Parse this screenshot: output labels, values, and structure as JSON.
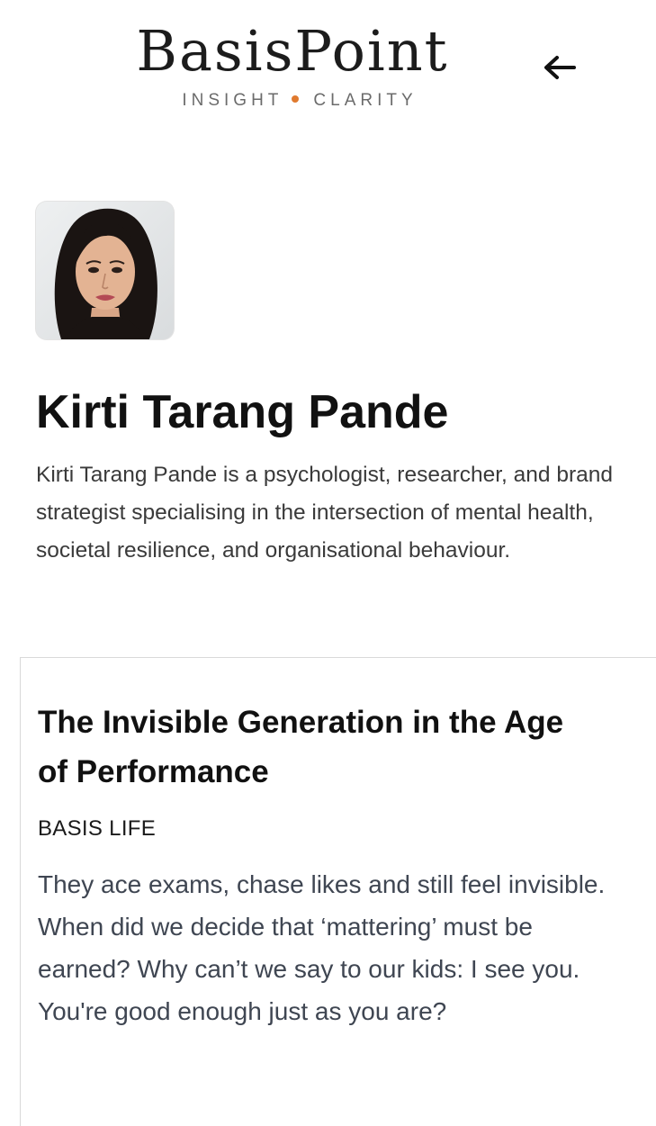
{
  "header": {
    "logo_text": "BasisPoint",
    "tagline_left": "INSIGHT",
    "tagline_right": "CLARITY",
    "back_icon": "arrow-left-icon"
  },
  "author": {
    "avatar_alt": "Kirti Tarang Pande",
    "name": "Kirti Tarang Pande",
    "bio": "Kirti Tarang Pande is a psychologist, researcher, and brand strategist specialising in the intersection of mental health, societal resilience, and organisational behaviour."
  },
  "article": {
    "title": "The Invisible Generation in the Age of Performance",
    "category": "BASIS LIFE",
    "excerpt": "They ace exams, chase likes and still feel invisible. When did we decide that ‘mattering’ must be earned? Why can’t we say to our kids: I see you. You're good enough just as you are?"
  },
  "colors": {
    "accent_dot": "#e07a2f",
    "logo": "#1c1c1c",
    "excerpt_text": "#3f4652"
  }
}
